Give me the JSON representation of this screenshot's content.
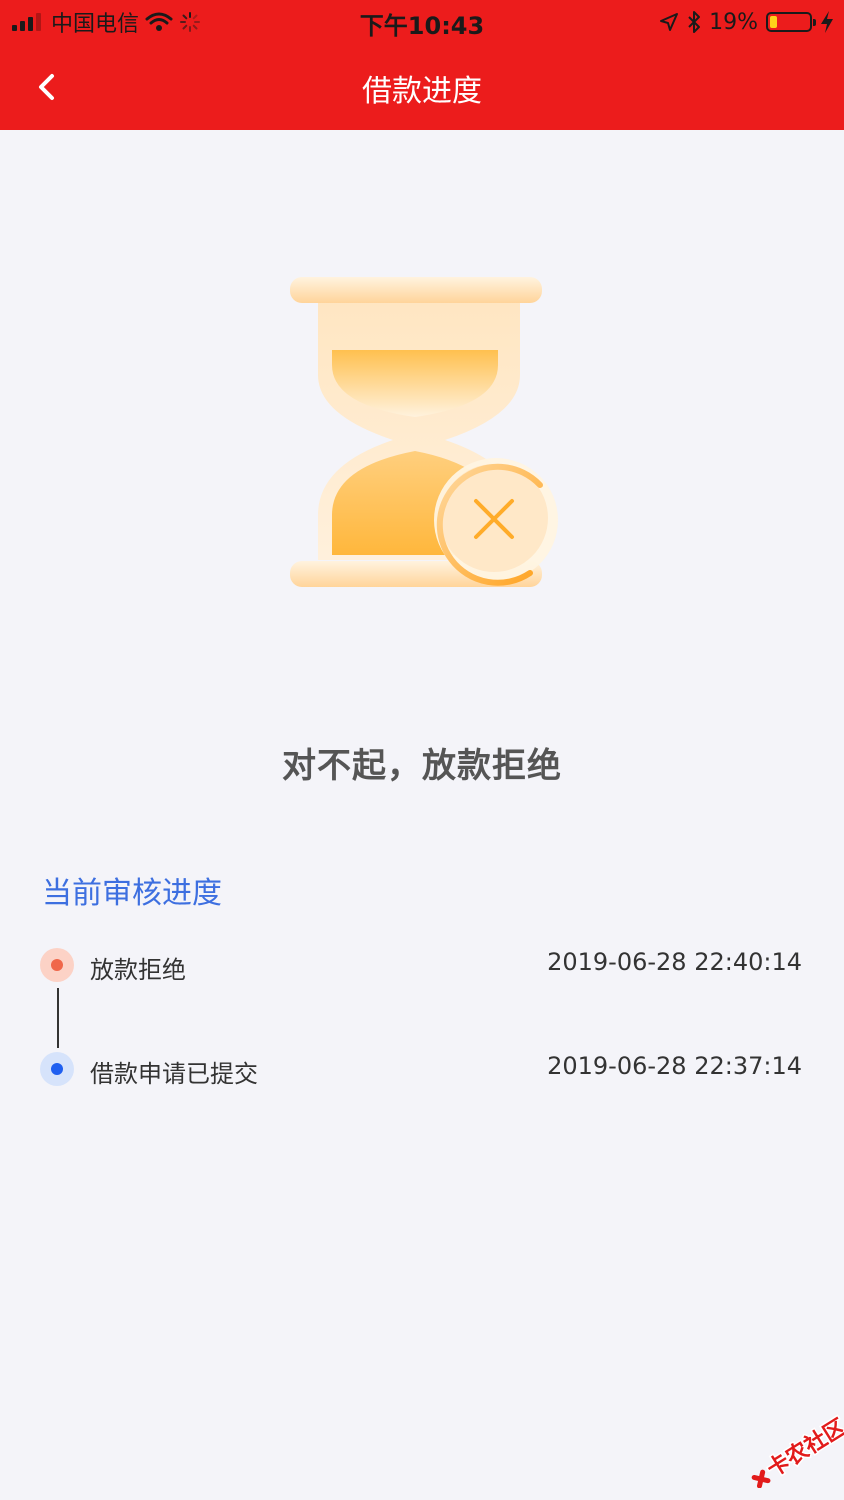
{
  "status_bar": {
    "carrier": "中国电信",
    "time": "下午10:43",
    "battery_percent": "19%",
    "battery_level": 0.19,
    "icons": [
      "signal-icon",
      "wifi-icon",
      "activity-spinner-icon",
      "location-arrow-icon",
      "bluetooth-icon",
      "battery-icon",
      "charging-bolt-icon"
    ]
  },
  "nav": {
    "title": "借款进度",
    "back_icon": "chevron-left-icon"
  },
  "result": {
    "illustration": "hourglass-rejected-illustration",
    "message": "对不起，放款拒绝"
  },
  "progress": {
    "section_title": "当前审核进度",
    "items": [
      {
        "label": "放款拒绝",
        "time": "2019-06-28 22:40:14",
        "status_color": "#f0674a"
      },
      {
        "label": "借款申请已提交",
        "time": "2019-06-28 22:37:14",
        "status_color": "#1f5ff0"
      }
    ]
  },
  "watermark": {
    "text": "卡农社区"
  },
  "colors": {
    "header_red": "#ec1c1c",
    "accent_blue": "#3d6fe0",
    "background": "#f4f4f9"
  }
}
